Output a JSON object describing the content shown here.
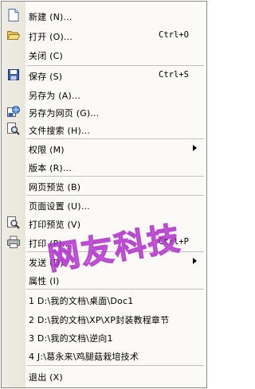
{
  "menu": {
    "items": [
      {
        "label": "新建 (N)...",
        "shortcut": "",
        "icon": "new-document-icon"
      },
      {
        "label": "打开 (O)...",
        "shortcut": "Ctrl+O",
        "icon": "open-folder-icon"
      },
      {
        "label": "关闭 (C)",
        "shortcut": ""
      },
      {
        "label": "保存 (S)",
        "shortcut": "Ctrl+S",
        "icon": "save-disk-icon"
      },
      {
        "label": "另存为 (A)...",
        "shortcut": ""
      },
      {
        "label": "另存为网页 (G)...",
        "shortcut": "",
        "icon": "save-web-page-icon"
      },
      {
        "label": "文件搜索 (H)...",
        "shortcut": "",
        "icon": "file-search-icon"
      },
      {
        "label": "权限 (M)",
        "shortcut": "",
        "submenu": true
      },
      {
        "label": "版本 (R)...",
        "shortcut": ""
      },
      {
        "label": "网页预览 (B)",
        "shortcut": ""
      },
      {
        "label": "页面设置 (U)...",
        "shortcut": ""
      },
      {
        "label": "打印预览 (V)",
        "shortcut": "",
        "icon": "print-preview-icon"
      },
      {
        "label": "打印 (P)...",
        "shortcut": "Ctrl+P",
        "icon": "printer-icon"
      },
      {
        "label": "发送 (D)",
        "shortcut": "",
        "submenu": true
      },
      {
        "label": "属性 (I)",
        "shortcut": ""
      },
      {
        "label": "1 D:\\我的文档\\桌面\\Doc1",
        "shortcut": ""
      },
      {
        "label": "2 D:\\我的文档\\XP\\XP封装教程章节",
        "shortcut": ""
      },
      {
        "label": "3 D:\\我的文档\\逆向1",
        "shortcut": ""
      },
      {
        "label": "4 J:\\葛永来\\鸡腿菇栽培技术",
        "shortcut": ""
      },
      {
        "label": "退出 (X)",
        "shortcut": ""
      }
    ]
  },
  "watermark": {
    "text": "网友科技"
  },
  "colors": {
    "watermark": "#c85ad8",
    "sidebar": "#ebe8dd",
    "separator": "#c5c2b8"
  }
}
